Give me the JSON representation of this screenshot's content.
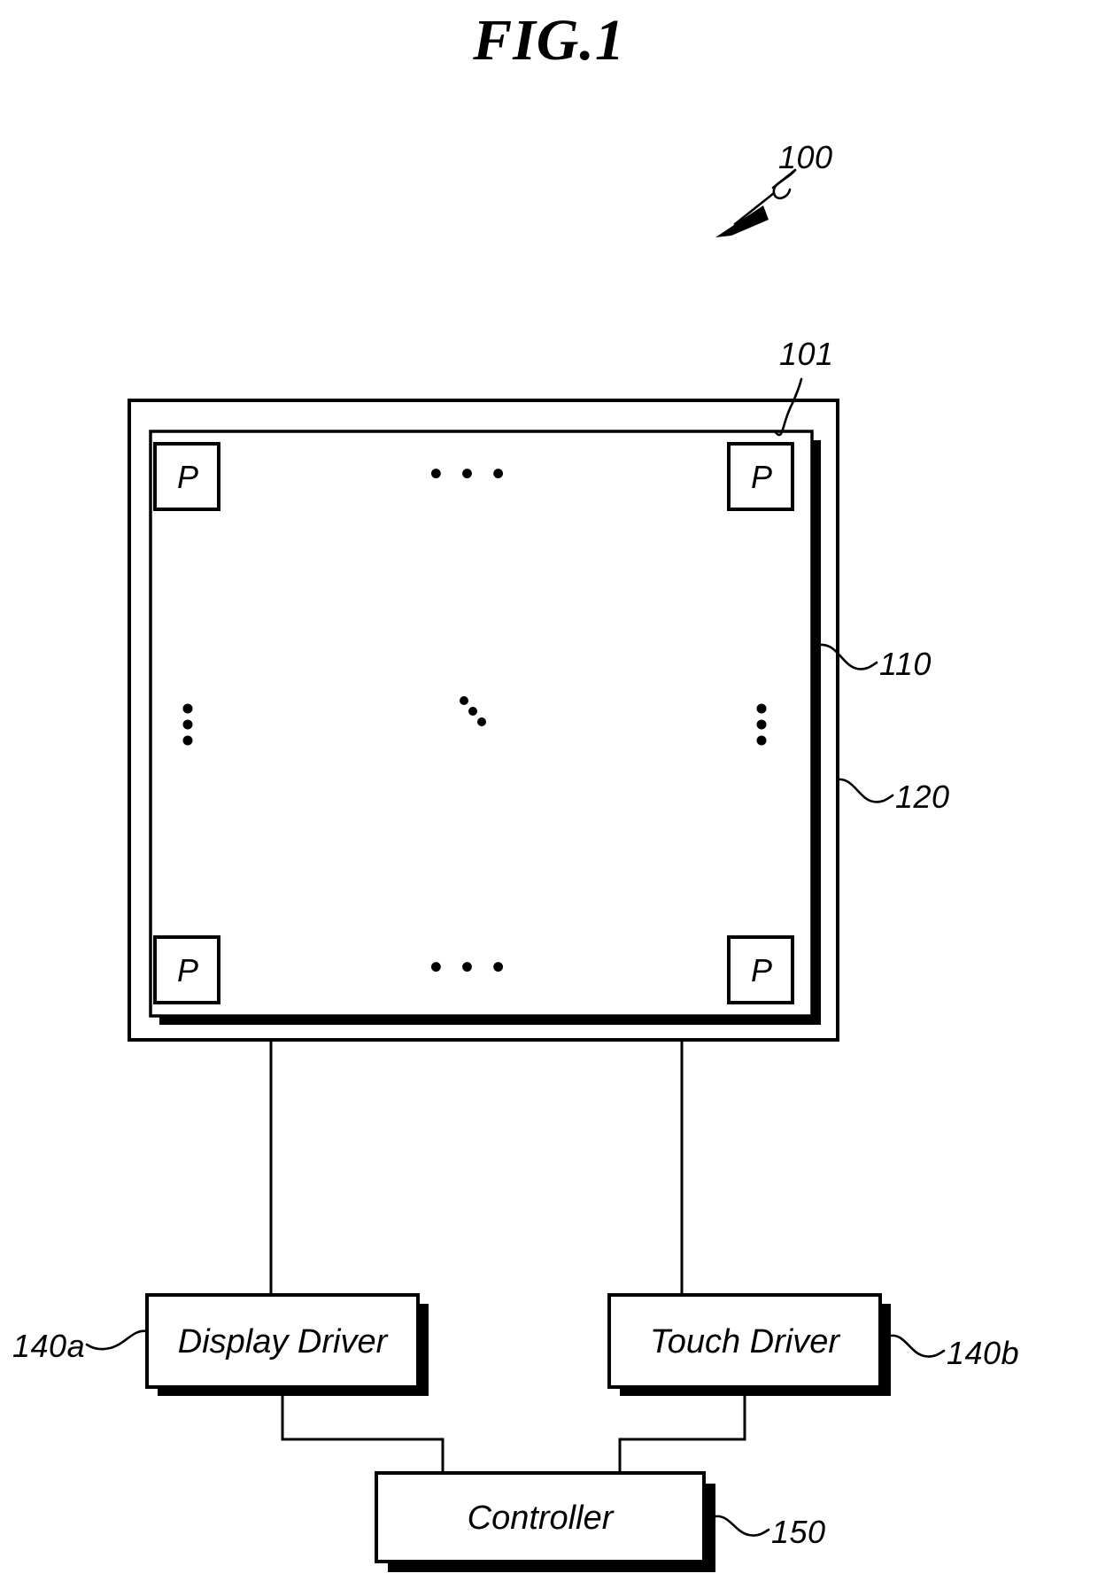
{
  "figure": {
    "title": "FIG.1",
    "type": "patent-diagram",
    "description": "Touch display device block diagram"
  },
  "reference_numerals": {
    "device": "100",
    "active_area": "101",
    "display_panel": "110",
    "touch_panel": "120",
    "display_driver_ref": "140a",
    "touch_driver_ref": "140b",
    "controller_ref": "150"
  },
  "panel": {
    "pixels": [
      {
        "label": "P",
        "position": "top-left"
      },
      {
        "label": "P",
        "position": "top-right"
      },
      {
        "label": "P",
        "position": "bottom-left"
      },
      {
        "label": "P",
        "position": "bottom-right"
      }
    ],
    "ellipsis_top": "• • •",
    "ellipsis_bottom": "• • •",
    "ellipsis_left": "vertical-dots",
    "ellipsis_right": "vertical-dots",
    "ellipsis_center": "diagonal-dots"
  },
  "blocks": {
    "display_driver": {
      "label": "Display Driver"
    },
    "touch_driver": {
      "label": "Touch Driver"
    },
    "controller": {
      "label": "Controller"
    }
  },
  "colors": {
    "ink": "#000000",
    "paper": "#ffffff"
  }
}
